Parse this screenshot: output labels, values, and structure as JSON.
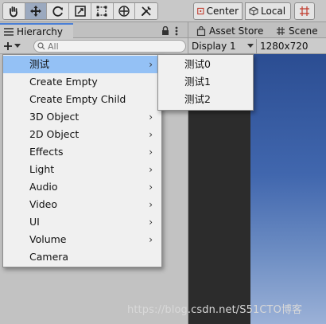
{
  "toolbar": {
    "center_label": "Center",
    "local_label": "Local"
  },
  "hierarchy": {
    "tab_label": "Hierarchy",
    "search_placeholder": "All"
  },
  "right_tabs": {
    "asset_store": "Asset Store",
    "scene": "Scene"
  },
  "game_toolbar": {
    "display": "Display 1",
    "resolution": "1280x720"
  },
  "context_menu": {
    "items": [
      {
        "label": "测试",
        "has_submenu": true,
        "highlighted": true
      },
      {
        "label": "Create Empty",
        "has_submenu": false
      },
      {
        "label": "Create Empty Child",
        "has_submenu": false
      },
      {
        "label": "3D Object",
        "has_submenu": true
      },
      {
        "label": "2D Object",
        "has_submenu": true
      },
      {
        "label": "Effects",
        "has_submenu": true
      },
      {
        "label": "Light",
        "has_submenu": true
      },
      {
        "label": "Audio",
        "has_submenu": true
      },
      {
        "label": "Video",
        "has_submenu": true
      },
      {
        "label": "UI",
        "has_submenu": true
      },
      {
        "label": "Volume",
        "has_submenu": true
      },
      {
        "label": "Camera",
        "has_submenu": false
      }
    ],
    "arrow_glyph": "›"
  },
  "submenu": {
    "items": [
      "测试0",
      "测试1",
      "测试2"
    ]
  },
  "watermark": "https://blog.csdn.net/S51CTO博客",
  "colors": {
    "highlight": "#94c1f5",
    "tab_accent": "#4a7fd6",
    "sky_top": "#2b4d92",
    "sky_bottom": "#9bb1d7"
  }
}
